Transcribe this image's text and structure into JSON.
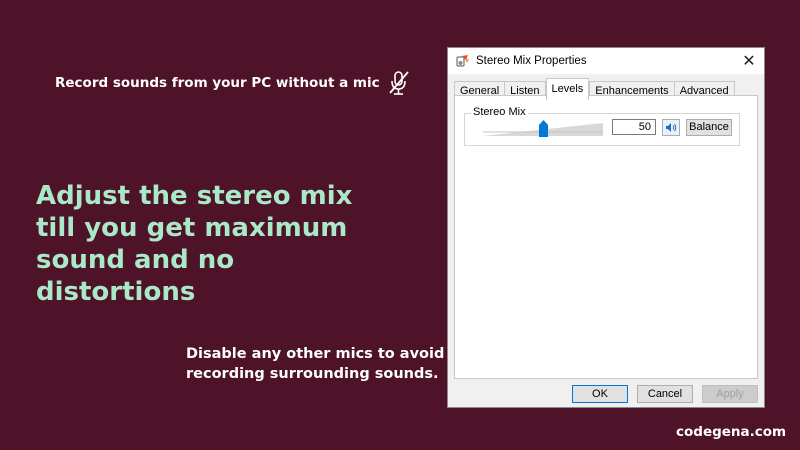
{
  "slide": {
    "subtitle": "Record sounds from your PC without a mic",
    "headline": "Adjust the stereo mix till you get maximum sound and no distortions",
    "tip": "Disable any other mics to avoid recording surrounding sounds.",
    "brand": "codegena.com",
    "icons": {
      "subtitle_icon": "mic-off-icon"
    },
    "colors": {
      "background": "#4e1229",
      "headline": "#a9e9c8",
      "text": "#ffffff"
    }
  },
  "dialog": {
    "title": "Stereo Mix Properties",
    "close_glyph": "✕",
    "tabs": [
      {
        "label": "General"
      },
      {
        "label": "Listen"
      },
      {
        "label": "Levels",
        "active": true
      },
      {
        "label": "Enhancements"
      },
      {
        "label": "Advanced"
      }
    ],
    "levels": {
      "group_label": "Stereo Mix",
      "value": "50",
      "slider_level": 0.5,
      "speaker_icon": "speaker-icon",
      "balance_label": "Balance"
    },
    "buttons": {
      "ok": "OK",
      "cancel": "Cancel",
      "apply": "Apply"
    },
    "colors": {
      "accent": "#0078d7"
    }
  }
}
